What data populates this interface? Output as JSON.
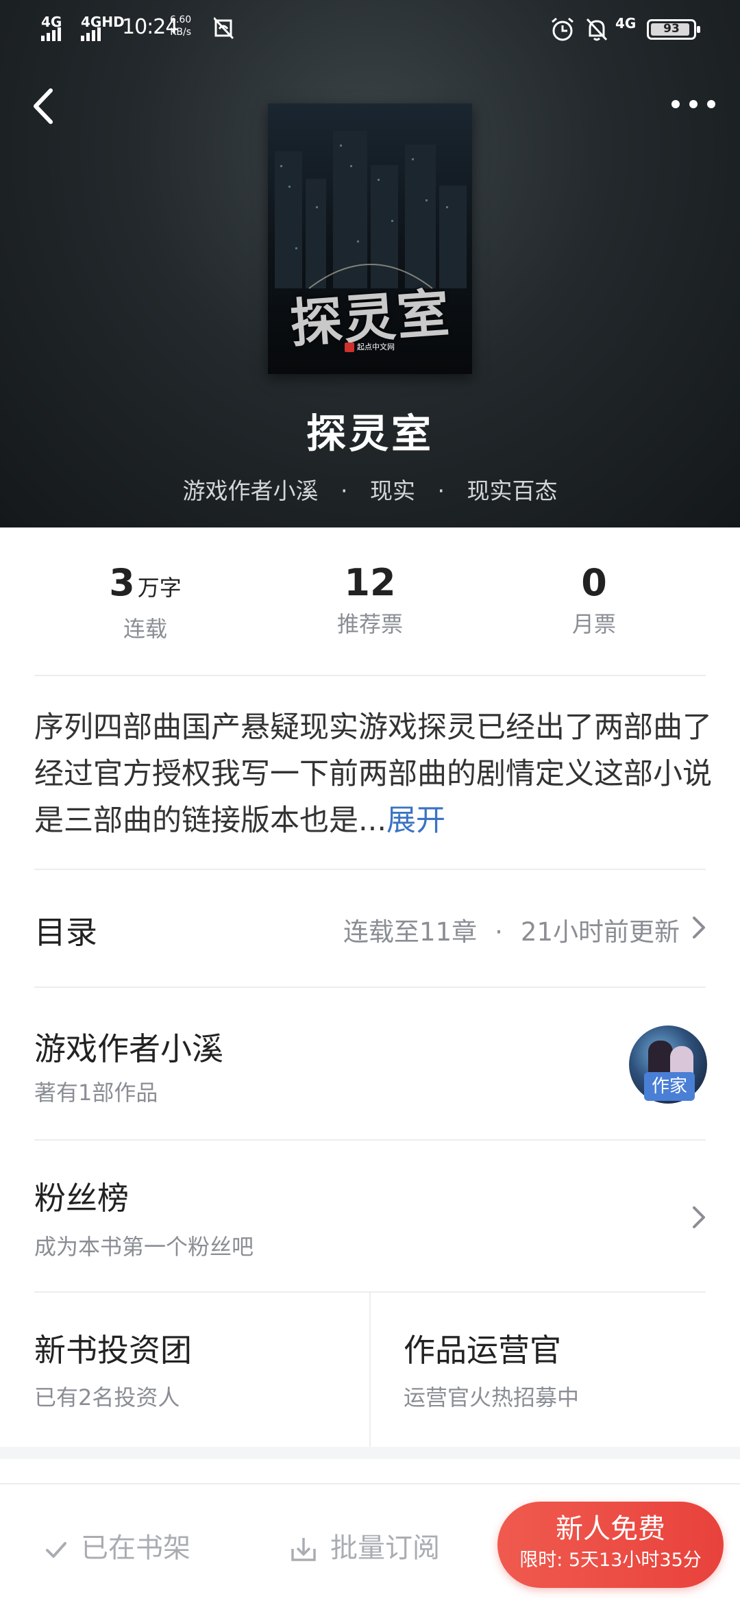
{
  "status_bar": {
    "network1": "4G",
    "network2": "4GHD",
    "time": "10:24",
    "speed_value": "6.60",
    "speed_unit": "KB/s",
    "network3": "4G",
    "battery": "93",
    "battery_level_percent": 93
  },
  "header": {
    "back_icon": "chevron-left-icon",
    "more_icon": "more-dots-icon"
  },
  "book": {
    "cover_title": "探灵室",
    "cover_publisher": "起点中文网",
    "title": "探灵室",
    "author": "游戏作者小溪",
    "category": "现实",
    "subcategory": "现实百态",
    "separator": "·"
  },
  "stats": [
    {
      "value": "3",
      "unit": "万字",
      "label": "连载"
    },
    {
      "value": "12",
      "unit": "",
      "label": "推荐票"
    },
    {
      "value": "0",
      "unit": "",
      "label": "月票"
    }
  ],
  "synopsis": {
    "text": "序列四部曲国产悬疑现实游戏探灵已经出了两部曲了经过官方授权我写一下前两部曲的剧情定义这部小说是三部曲的链接版本也是...",
    "expand_label": "展开"
  },
  "toc": {
    "title": "目录",
    "progress": "连载至11章",
    "separator": "·",
    "updated": "21小时前更新"
  },
  "author_section": {
    "name": "游戏作者小溪",
    "works": "著有1部作品",
    "badge": "作家"
  },
  "fans": {
    "title": "粉丝榜",
    "subtitle": "成为本书第一个粉丝吧"
  },
  "investment": {
    "title": "新书投资团",
    "subtitle": "已有2名投资人"
  },
  "operator": {
    "title": "作品运营官",
    "subtitle": "运营官火热招募中"
  },
  "bottom_bar": {
    "shelf_label": "已在书架",
    "subscribe_label": "批量订阅",
    "free_title": "新人免费",
    "free_subtitle": "限时: 5天13小时35分"
  },
  "colors": {
    "accent_link": "#3a73c4",
    "cta_red": "#e8423c",
    "badge_blue": "#4a7fd6"
  }
}
